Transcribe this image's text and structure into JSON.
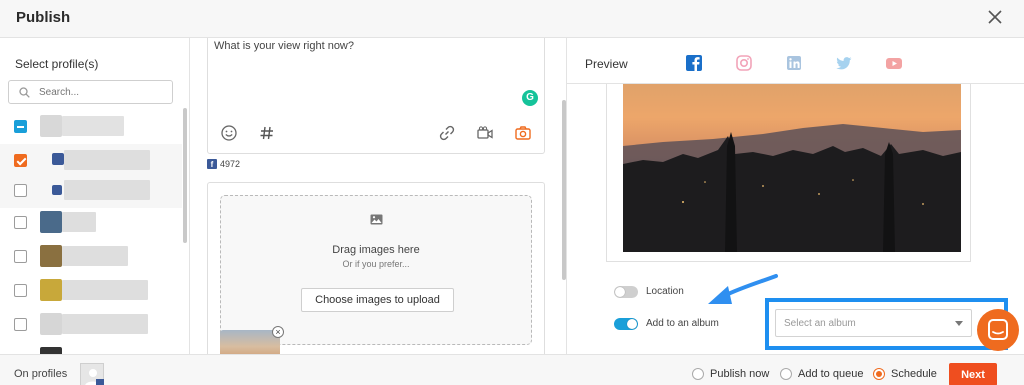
{
  "header": {
    "title": "Publish",
    "close_icon": "close-icon"
  },
  "sidebar": {
    "heading": "Select profile(s)",
    "search_placeholder": "Search...",
    "profiles": [
      {
        "state": "indeterminate"
      },
      {
        "state": "checked"
      },
      {
        "state": "unchecked"
      },
      {
        "state": "unchecked"
      },
      {
        "state": "unchecked"
      },
      {
        "state": "unchecked"
      },
      {
        "state": "unchecked"
      }
    ]
  },
  "compose": {
    "placeholder": "What is your view right now?",
    "grammarly_letter": "G",
    "tools": [
      "emoji-icon",
      "hashtag-icon",
      "link-icon",
      "video-icon",
      "camera-icon"
    ],
    "fb_count": "4972"
  },
  "upload": {
    "drag_text": "Drag images here",
    "prefer_text": "Or if you prefer...",
    "choose_button": "Choose images to upload",
    "remove_label": "×"
  },
  "preview": {
    "label": "Preview",
    "tabs": [
      "facebook-icon",
      "instagram-icon",
      "linkedin-icon",
      "twitter-icon",
      "youtube-icon"
    ],
    "active_tab": "facebook-icon",
    "options": [
      {
        "label": "Location",
        "enabled": false
      },
      {
        "label": "Add to an album",
        "enabled": true
      }
    ],
    "album_placeholder": "Select an album"
  },
  "footer": {
    "on_profiles": "On profiles",
    "options": [
      {
        "label": "Publish now",
        "selected": false
      },
      {
        "label": "Add to queue",
        "selected": false
      },
      {
        "label": "Schedule",
        "selected": true
      }
    ],
    "next_button": "Next"
  },
  "colors": {
    "accent": "#ef6b1f",
    "next": "#ef4e1f",
    "highlight": "#1e8ff0",
    "toggle_on": "#1a9fd9",
    "facebook": "#3b5998"
  }
}
